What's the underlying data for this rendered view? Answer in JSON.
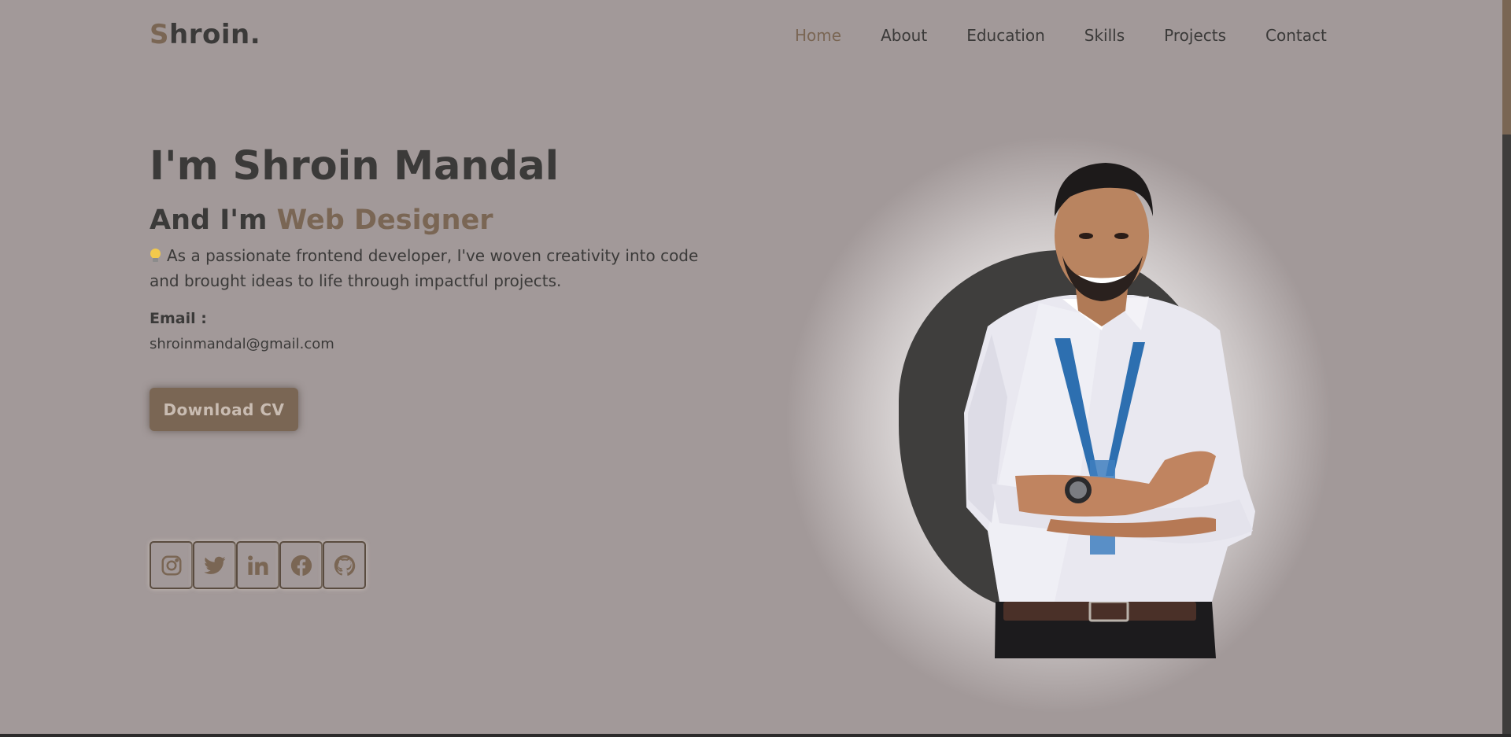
{
  "header": {
    "logo_initial": "S",
    "logo_rest": "hroin.",
    "nav": [
      {
        "label": "Home",
        "active": true
      },
      {
        "label": "About"
      },
      {
        "label": "Education"
      },
      {
        "label": "Skills"
      },
      {
        "label": "Projects"
      },
      {
        "label": "Contact"
      }
    ]
  },
  "hero": {
    "title": "I'm Shroin Mandal",
    "subtitle_prefix": "And I'm",
    "subtitle_role": "Web Designer",
    "description": "As a passionate frontend developer, I've woven creativity into code and brought ideas to life through impactful projects.",
    "email_label": "Email :",
    "email_value": "shroinmandal@gmail.com",
    "cv_button": "Download CV"
  },
  "social": [
    {
      "icon": "instagram-icon"
    },
    {
      "icon": "twitter-icon"
    },
    {
      "icon": "linkedin-icon"
    },
    {
      "icon": "facebook-icon"
    },
    {
      "icon": "github-icon"
    }
  ],
  "colors": {
    "background": "#a29999",
    "accent": "#7a6654",
    "text": "#3b3a39",
    "blob": "#3f3e3d"
  }
}
